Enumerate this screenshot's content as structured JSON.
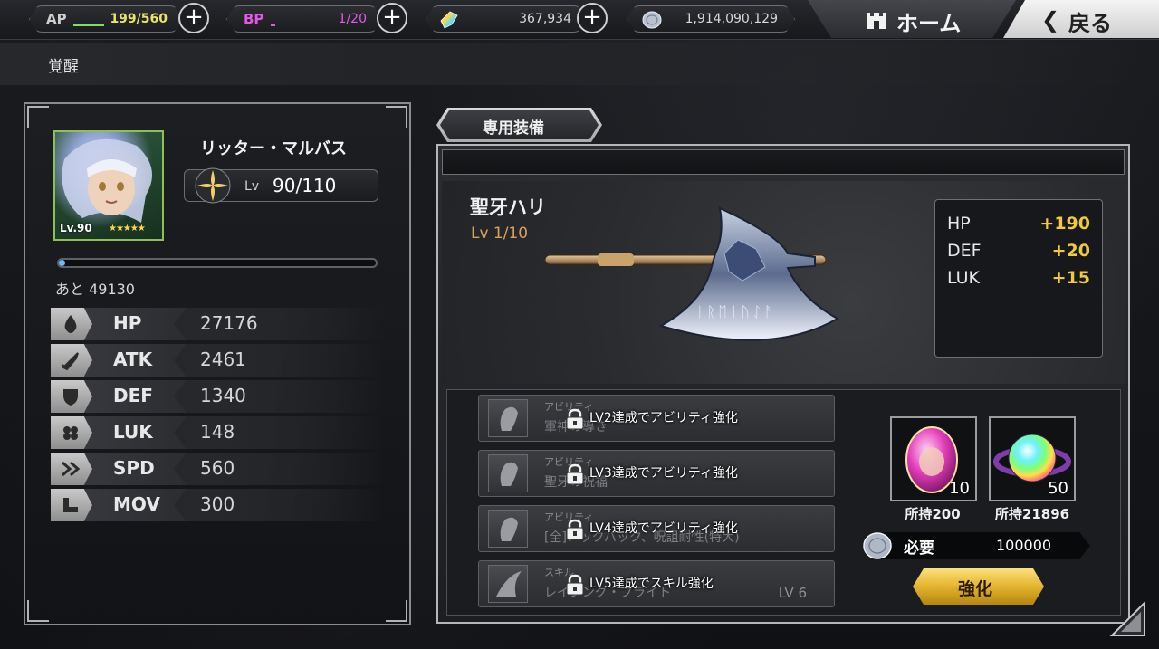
{
  "topbar": {
    "ap": {
      "label": "AP",
      "value": "199/560",
      "label_color": "#cfcfcf",
      "value_color": "#e9e46a",
      "gauge_color": "#7be063",
      "fill": 0.355
    },
    "bp": {
      "label": "BP",
      "value": "1/20",
      "label_color": "#e259e8",
      "value_color": "#e259e8",
      "gauge_color": "#e259e8",
      "fill": 0.05
    },
    "crystal": {
      "value": "367,934",
      "icon": "rainbow-crystal-icon"
    },
    "coin": {
      "value": "1,914,090,129",
      "icon": "silver-coin-icon"
    },
    "plus_icon": "plus-icon",
    "home_label": "ホーム",
    "home_icon": "castle-icon",
    "back_label": "戻る",
    "back_icon": "chevron-left-icon"
  },
  "page": {
    "title": "覚醒"
  },
  "character": {
    "name": "リッター・マルバス",
    "portrait_level": "Lv.90",
    "stars": "★★★★★",
    "level_prefix": "Lv",
    "level": "90/110",
    "exp_remaining": "あと 49130",
    "exp_fill": 0.02,
    "stats": [
      {
        "name": "HP",
        "value": "27176",
        "icon": "water-drop-icon"
      },
      {
        "name": "ATK",
        "value": "2461",
        "icon": "sword-icon"
      },
      {
        "name": "DEF",
        "value": "1340",
        "icon": "shield-icon"
      },
      {
        "name": "LUK",
        "value": "148",
        "icon": "clover-icon"
      },
      {
        "name": "SPD",
        "value": "560",
        "icon": "double-chevron-icon"
      },
      {
        "name": "MOV",
        "value": "300",
        "icon": "boot-icon"
      }
    ]
  },
  "equipment": {
    "tab_label": "専用装備",
    "name": "聖牙ハリ",
    "level": "Lv  1/10",
    "bonuses": [
      {
        "name": "HP",
        "value": "+190"
      },
      {
        "name": "DEF",
        "value": "+20"
      },
      {
        "name": "LUK",
        "value": "+15"
      }
    ],
    "abilities": [
      {
        "type": "アビリティ",
        "name": "軍神の導き",
        "lock_message": "LV2達成でアビリティ強化",
        "level": ""
      },
      {
        "type": "アビリティ",
        "name": "聖牙の祝福",
        "lock_message": "LV3達成でアビリティ強化",
        "level": ""
      },
      {
        "type": "アビリティ",
        "name": "[全]ノックバック、呪詛耐性(特大)",
        "lock_message": "LV4達成でアビリティ強化",
        "level": ""
      },
      {
        "type": "スキル",
        "name": "レイジング・ブライト",
        "lock_message": "LV5達成でスキル強化",
        "level": "LV 6"
      }
    ],
    "materials": [
      {
        "count": "10",
        "owned": "所持200",
        "icon": "pink-gem-icon"
      },
      {
        "count": "50",
        "owned": "所持21896",
        "icon": "rainbow-orb-icon"
      }
    ],
    "cost_label": "必要",
    "cost_value": "100000",
    "enhance_label": "強化"
  }
}
